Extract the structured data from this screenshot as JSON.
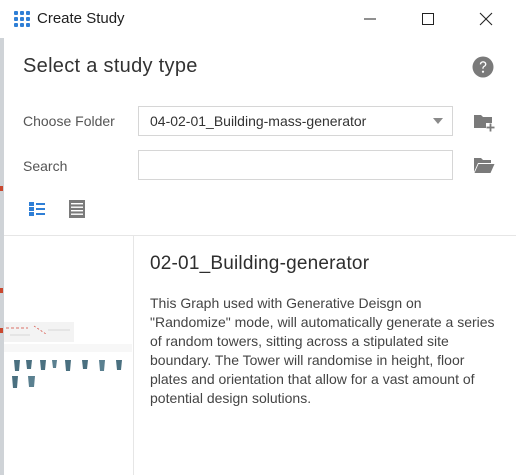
{
  "window": {
    "title": "Create Study",
    "icon": "app-grid-icon",
    "controls": [
      "minimize-icon",
      "maximize-icon",
      "close-icon"
    ]
  },
  "dialog": {
    "heading": "Select a study type",
    "help_icon": "question-circle-icon"
  },
  "folder": {
    "label": "Choose Folder",
    "selected": "04-02-01_Building-mass-generator",
    "action_icon": "new-folder-icon"
  },
  "search": {
    "label": "Search",
    "value": "",
    "placeholder": "",
    "action_icon": "open-folder-icon"
  },
  "view_toggle": {
    "tile_icon": "tile-view-icon",
    "list_icon": "list-view-icon",
    "active": "tile"
  },
  "study": {
    "title": "02-01_Building-generator",
    "description": "This Graph used with Generative Deisgn on \"Randomize\" mode, will automatically generate a series of random towers, sitting across a stipulated site boundary. The Tower will randomise in height, floor plates and orientation that allow for a vast amount of potential design solutions."
  },
  "colors": {
    "accent": "#2f7fd6",
    "icon_gray": "#7a7a7a",
    "border": "#d6d6d6"
  }
}
